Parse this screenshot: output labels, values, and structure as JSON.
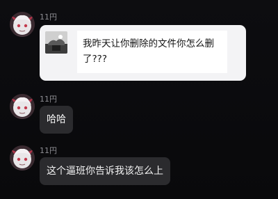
{
  "messages": [
    {
      "sender": "11円",
      "type": "quote-card",
      "text": "我昨天让你删除的文件你怎么删了???"
    },
    {
      "sender": "11円",
      "type": "text",
      "text": "哈哈"
    },
    {
      "sender": "11円",
      "type": "text",
      "text": "这个逼班你告诉我该怎么上"
    }
  ],
  "icons": {
    "avatar": "anime-avatar-icon",
    "thumbnail": "file-thumbnail-icon"
  },
  "colors": {
    "background": "#0b0b0d",
    "dark_bubble": "#2b2b2e",
    "light_card": "#f3f3f5",
    "sender_text": "#8e8e93"
  }
}
